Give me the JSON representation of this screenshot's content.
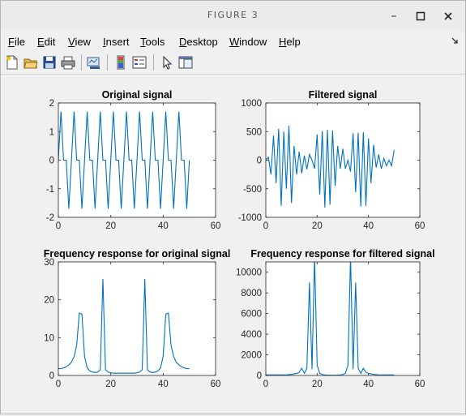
{
  "window": {
    "title": "FIGURE 3",
    "controls": {
      "minimize": "–",
      "maximize": "□",
      "close": "×"
    }
  },
  "menubar": {
    "items": [
      {
        "label": "File",
        "accel": "F",
        "rest": "ile"
      },
      {
        "label": "Edit",
        "accel": "E",
        "rest": "dit"
      },
      {
        "label": "View",
        "accel": "V",
        "rest": "iew"
      },
      {
        "label": "Insert",
        "accel": "I",
        "rest": "nsert"
      },
      {
        "label": "Tools",
        "accel": "T",
        "rest": "ools"
      },
      {
        "label": "Desktop",
        "accel": "D",
        "rest": "esktop"
      },
      {
        "label": "Window",
        "accel": "W",
        "rest": "indow"
      },
      {
        "label": "Help",
        "accel": "H",
        "rest": "elp"
      }
    ],
    "overflow_icon": "dock-arrow-icon"
  },
  "toolbar": {
    "buttons": [
      "new-figure-icon",
      "open-file-icon",
      "save-icon",
      "print-icon",
      "link-plot-icon",
      "colorbar-icon",
      "legend-icon",
      "pointer-icon",
      "property-editor-icon"
    ]
  },
  "colors": {
    "line": "#0072bd",
    "axis": "#262626",
    "bg": "#ffffff"
  },
  "chart_data": [
    {
      "type": "line",
      "title": "Original signal",
      "xlim": [
        0,
        60
      ],
      "ylim": [
        -2,
        2
      ],
      "xticks": [
        0,
        20,
        40,
        60
      ],
      "yticks": [
        -2,
        -1,
        0,
        1,
        2
      ],
      "x": [
        0,
        1,
        2,
        3,
        4,
        5,
        6,
        7,
        8,
        9,
        10,
        11,
        12,
        13,
        14,
        15,
        16,
        17,
        18,
        19,
        20,
        21,
        22,
        23,
        24,
        25,
        26,
        27,
        28,
        29,
        30,
        31,
        32,
        33,
        34,
        35,
        36,
        37,
        38,
        39,
        40,
        41,
        42,
        43,
        44,
        45,
        46,
        47,
        48,
        49,
        50
      ],
      "y": [
        0,
        1.7,
        0,
        0,
        -1.7,
        0,
        1.7,
        0,
        0,
        -1.7,
        0,
        1.7,
        0,
        0,
        -1.7,
        0,
        1.7,
        0,
        0,
        -1.7,
        0,
        1.7,
        0,
        0,
        -1.7,
        0,
        1.7,
        0,
        0,
        -1.7,
        0,
        1.7,
        0,
        0,
        -1.7,
        0,
        1.7,
        0,
        0,
        -1.7,
        0,
        1.7,
        0,
        0,
        -1.7,
        0,
        1.7,
        0,
        0,
        -1.7,
        0
      ]
    },
    {
      "type": "line",
      "title": "Filtered signal",
      "xlim": [
        0,
        60
      ],
      "ylim": [
        -1000,
        1000
      ],
      "xticks": [
        0,
        20,
        40,
        60
      ],
      "yticks": [
        -1000,
        -500,
        0,
        500,
        1000
      ],
      "x": [
        0,
        1,
        2,
        3,
        4,
        5,
        6,
        7,
        8,
        9,
        10,
        11,
        12,
        13,
        14,
        15,
        16,
        17,
        18,
        19,
        20,
        21,
        22,
        23,
        24,
        25,
        26,
        27,
        28,
        29,
        30,
        31,
        32,
        33,
        34,
        35,
        36,
        37,
        38,
        39,
        40,
        41,
        42,
        43,
        44,
        45,
        46,
        47,
        48,
        49,
        50
      ],
      "y": [
        0,
        50,
        -250,
        430,
        -400,
        550,
        -800,
        500,
        -500,
        600,
        -750,
        250,
        -250,
        150,
        -230,
        80,
        -160,
        100,
        0,
        -150,
        450,
        -600,
        510,
        -830,
        530,
        -780,
        520,
        -450,
        250,
        -150,
        200,
        -150,
        0,
        -200,
        470,
        -560,
        480,
        -810,
        490,
        -800,
        380,
        -400,
        270,
        -130,
        100,
        -150,
        30,
        -100,
        0,
        -100,
        180
      ]
    },
    {
      "type": "line",
      "title": "Frequency response for original signal",
      "xlim": [
        0,
        60
      ],
      "ylim": [
        0,
        30
      ],
      "xticks": [
        0,
        20,
        40,
        60
      ],
      "yticks": [
        0,
        10,
        20,
        30
      ],
      "x": [
        0,
        1,
        2,
        3,
        4,
        5,
        6,
        7,
        8,
        9,
        10,
        11,
        12,
        13,
        14,
        15,
        16,
        17,
        18,
        19,
        20,
        21,
        22,
        23,
        24,
        25,
        26,
        27,
        28,
        29,
        30,
        31,
        32,
        33,
        34,
        35,
        36,
        37,
        38,
        39,
        40,
        41,
        42,
        43,
        44,
        45,
        46,
        47,
        48,
        49,
        50
      ],
      "y": [
        1.8,
        1.8,
        2,
        2.3,
        2.8,
        3.5,
        5,
        8,
        16.5,
        16.2,
        5,
        2,
        1.2,
        0.9,
        0.8,
        0.9,
        1.5,
        25.5,
        1.5,
        0.9,
        0.7,
        0.6,
        0.6,
        0.6,
        0.6,
        0.6,
        0.6,
        0.6,
        0.6,
        0.6,
        0.7,
        0.9,
        1.5,
        25.5,
        1.5,
        0.9,
        0.8,
        0.9,
        1.2,
        2,
        5,
        16.2,
        16.5,
        8,
        5,
        3.5,
        2.8,
        2.3,
        2,
        1.8,
        1.8
      ]
    },
    {
      "type": "line",
      "title": "Frequency response for filtered signal",
      "xlim": [
        0,
        60
      ],
      "ylim": [
        0,
        11000
      ],
      "xticks": [
        0,
        20,
        40,
        60
      ],
      "yticks": [
        0,
        2000,
        4000,
        6000,
        8000,
        10000
      ],
      "x": [
        0,
        1,
        2,
        3,
        4,
        5,
        6,
        7,
        8,
        9,
        10,
        11,
        12,
        13,
        14,
        15,
        16,
        17,
        18,
        19,
        20,
        21,
        22,
        23,
        24,
        25,
        26,
        27,
        28,
        29,
        30,
        31,
        32,
        33,
        34,
        35,
        36,
        37,
        38,
        39,
        40,
        41,
        42,
        43,
        44,
        45,
        46,
        47,
        48,
        49,
        50
      ],
      "y": [
        50,
        50,
        50,
        50,
        50,
        50,
        50,
        50,
        60,
        80,
        100,
        150,
        200,
        300,
        700,
        200,
        700,
        9000,
        600,
        11500,
        1000,
        200,
        100,
        50,
        30,
        30,
        30,
        30,
        30,
        50,
        100,
        200,
        1000,
        11500,
        600,
        9000,
        700,
        200,
        700,
        300,
        200,
        150,
        100,
        80,
        60,
        50,
        50,
        50,
        50,
        50,
        50
      ]
    }
  ]
}
